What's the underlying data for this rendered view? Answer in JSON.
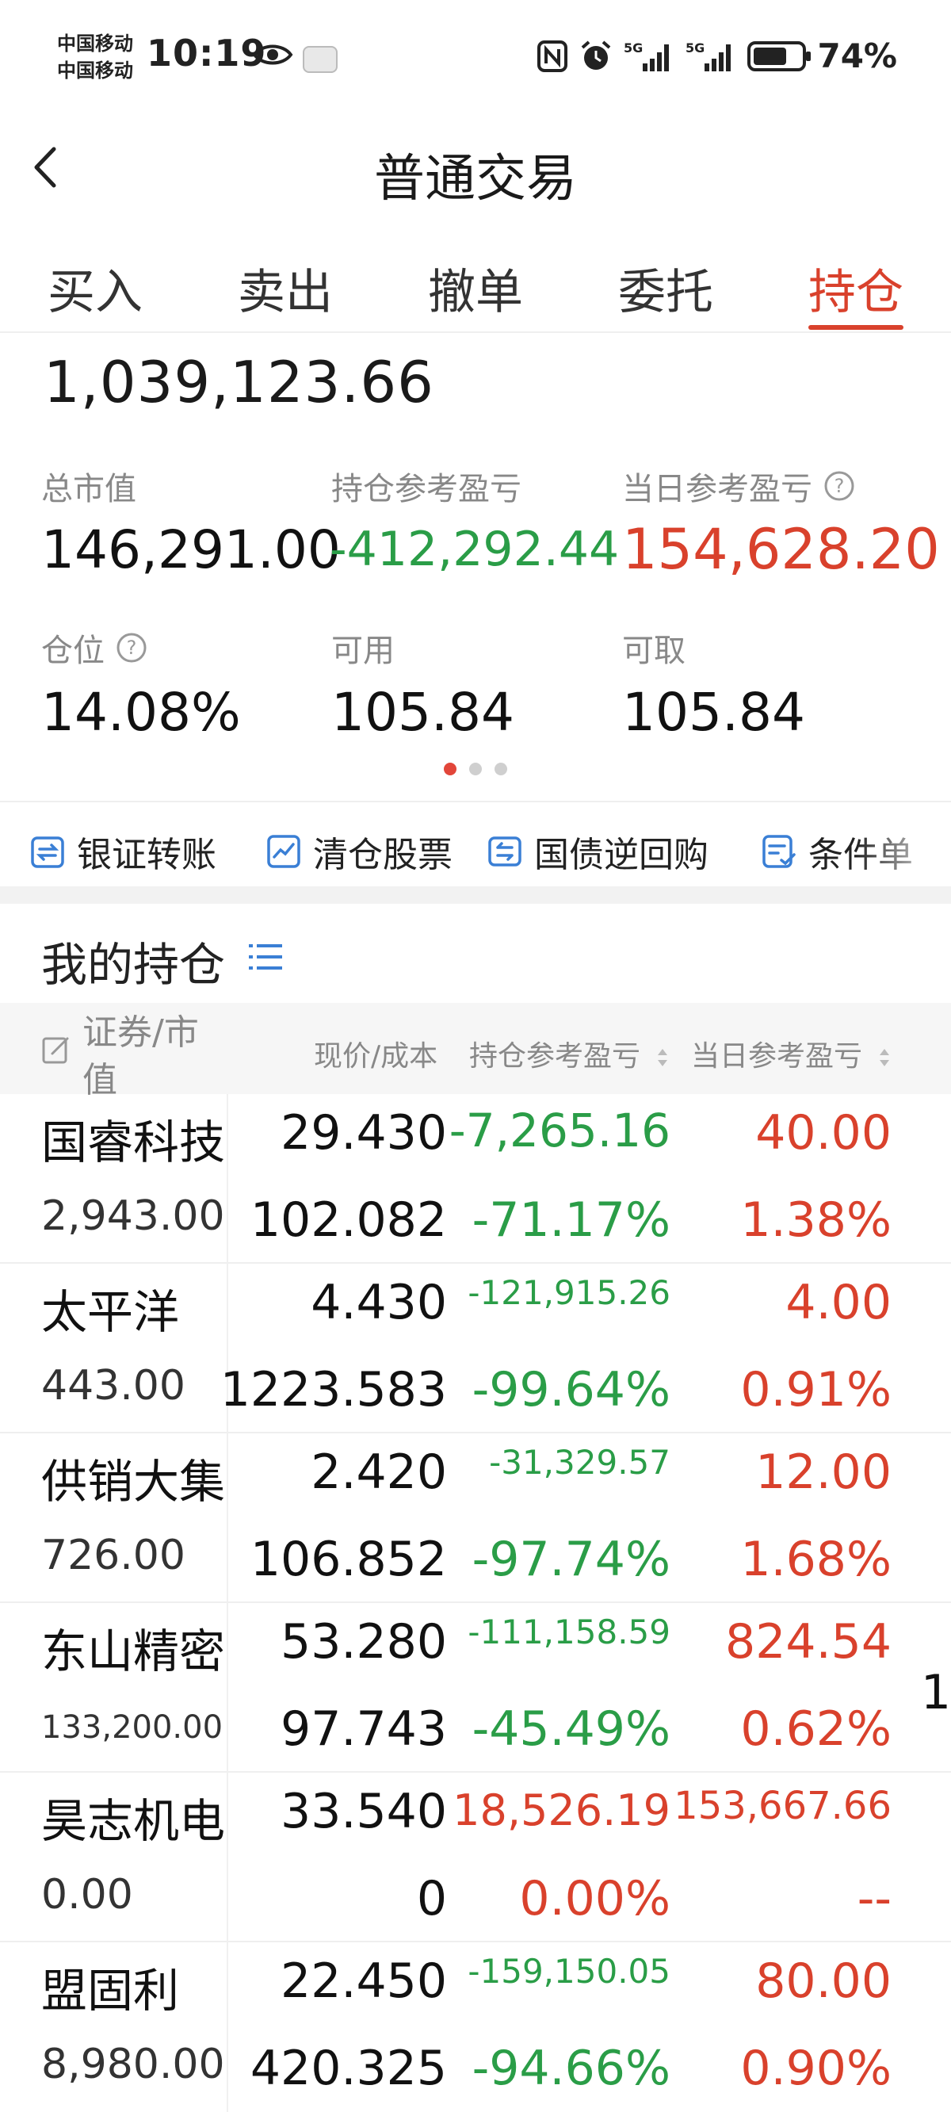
{
  "status_bar": {
    "carrier_1": "中国移动",
    "carrier_2": "中国移动",
    "time": "10:19",
    "battery": "74%",
    "net_1": "5G",
    "net_2": "5G"
  },
  "header": {
    "title": "普通交易"
  },
  "tabs": [
    {
      "label": "买入"
    },
    {
      "label": "卖出"
    },
    {
      "label": "撤单"
    },
    {
      "label": "委托"
    },
    {
      "label": "持仓"
    }
  ],
  "summary": {
    "total_assets": "1,039,123.66",
    "market_value_label": "总市值",
    "market_value": "146,291.00",
    "position_pl_label": "持仓参考盈亏",
    "position_pl": "-412,292.44",
    "day_pl_label": "当日参考盈亏",
    "day_pl": "154,628.20",
    "position_ratio_label": "仓位",
    "position_ratio": "14.08%",
    "available_label": "可用",
    "available": "105.84",
    "withdrawable_label": "可取",
    "withdrawable": "105.84"
  },
  "shortcuts": [
    {
      "label": "银证转账",
      "icon": "transfer-icon"
    },
    {
      "label": "清仓股票",
      "icon": "chart-clear-icon"
    },
    {
      "label": "国债逆回购",
      "icon": "repo-icon"
    },
    {
      "label": "条件单",
      "icon": "condition-icon"
    }
  ],
  "holdings": {
    "title": "我的持仓",
    "columns": {
      "security": "证券/市值",
      "price_cost": "现价/成本",
      "position_pl": "持仓参考盈亏",
      "day_pl": "当日参考盈亏"
    },
    "rows": [
      {
        "name": "国睿科技",
        "market_value": "2,943.00",
        "price": "29.430",
        "cost": "102.082",
        "pl": "-7,265.16",
        "pl_pct": "-71.17%",
        "day_pl": "40.00",
        "day_pct": "1.38%"
      },
      {
        "name": "太平洋",
        "market_value": "443.00",
        "price": "4.430",
        "cost": "1223.583",
        "pl": "-121,915.26",
        "pl_pct": "-99.64%",
        "day_pl": "4.00",
        "day_pct": "0.91%"
      },
      {
        "name": "供销大集",
        "market_value": "726.00",
        "price": "2.420",
        "cost": "106.852",
        "pl": "-31,329.57",
        "pl_pct": "-97.74%",
        "day_pl": "12.00",
        "day_pct": "1.68%"
      },
      {
        "name": "东山精密",
        "market_value": "133,200.00",
        "price": "53.280",
        "cost": "97.743",
        "pl": "-111,158.59",
        "pl_pct": "-45.49%",
        "day_pl": "824.54",
        "day_pct": "0.62%"
      },
      {
        "name": "昊志机电",
        "market_value": "0.00",
        "price": "33.540",
        "cost": "0",
        "pl": "18,526.19",
        "pl_pct": "0.00%",
        "day_pl": "153,667.66",
        "day_pct": "--"
      },
      {
        "name": "盟固利",
        "market_value": "8,980.00",
        "price": "22.450",
        "cost": "420.325",
        "pl": "-159,150.05",
        "pl_pct": "-94.66%",
        "day_pl": "80.00",
        "day_pct": "0.90%"
      }
    ],
    "edge_mark": "1"
  },
  "colors": {
    "accent": "#d9412c",
    "gain": "#d9412c",
    "loss": "#2a9d47",
    "muted": "#888888"
  }
}
